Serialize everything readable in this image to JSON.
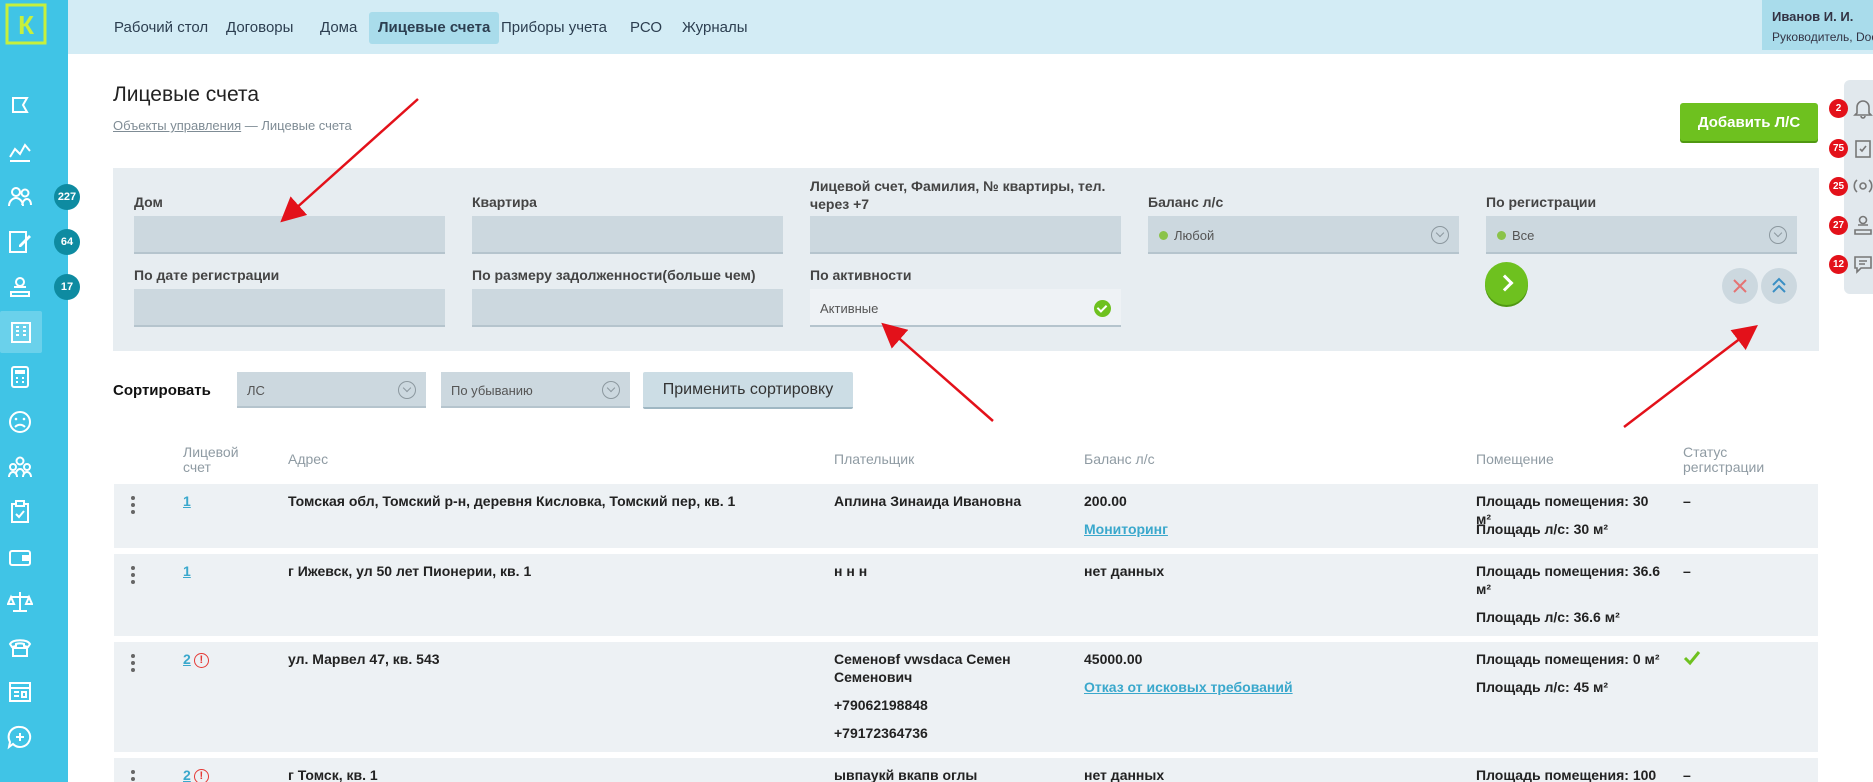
{
  "logo": {
    "letter": "К"
  },
  "nav": {
    "items": [
      "Рабочий стол",
      "Договоры",
      "Дома",
      "Лицевые счета",
      "Приборы учета",
      "РСО",
      "Журналы"
    ],
    "active_index": 3
  },
  "user": {
    "name": "Иванов И. И.",
    "role": "Руководитель, Doctor"
  },
  "sidebar": {
    "icons": [
      "flag-icon",
      "chart-icon",
      "people-icon",
      "edit-document-icon",
      "worker-icon",
      "building-icon",
      "calculator-icon",
      "sad-face-icon",
      "group-icon",
      "clipboard-check-icon",
      "wallet-icon",
      "scales-icon",
      "phone-icon",
      "dashboard-icon",
      "chat-plus-icon"
    ],
    "badges": {
      "people": "227",
      "edit": "64",
      "worker": "17"
    }
  },
  "page": {
    "title": "Лицевые счета",
    "breadcrumb_link": "Объекты управления",
    "breadcrumb_sep": "—",
    "breadcrumb_current": "Лицевые счета",
    "add_button": "Добавить Л/С"
  },
  "filters": {
    "house_label": "Дом",
    "flat_label": "Квартира",
    "search_label": "Лицевой счет, Фамилия, № квартиры, тел. через +7",
    "balance_label": "Баланс л/с",
    "balance_value": "Любой",
    "registration_label": "По регистрации",
    "registration_value": "Все",
    "reg_date_label": "По дате регистрации",
    "debt_label": "По размеру задолженности(больше чем)",
    "activity_label": "По активности",
    "activity_value": "Активные"
  },
  "sorting": {
    "label": "Сортировать",
    "field": "ЛС",
    "order": "По убыванию",
    "apply": "Применить сортировку"
  },
  "table": {
    "headers": {
      "account": "Лицевой счет",
      "address": "Адрес",
      "payer": "Плательщик",
      "balance": "Баланс л/с",
      "premises": "Помещение",
      "reg_status": "Статус регистрации"
    },
    "rows": [
      {
        "account": "1",
        "warning": false,
        "address": "Томская обл, Томский р-н, деревня Кисловка, Томский пер, кв. 1",
        "payer": "Аплина Зинаида Ивановна",
        "phones": [],
        "balance": "200.00",
        "balance_link": "Мониторинг",
        "area": "Площадь помещения: 30 м²",
        "area_ls": "Площадь л/с: 30 м²",
        "status": "–"
      },
      {
        "account": "1",
        "warning": false,
        "address": "г Ижевск, ул 50 лет Пионерии, кв. 1",
        "payer": "н н н",
        "phones": [],
        "balance": "нет данных",
        "balance_link": "",
        "area": "Площадь помещения: 36.6 м²",
        "area_ls": "Площадь л/с: 36.6 м²",
        "status": "–"
      },
      {
        "account": "2",
        "warning": true,
        "address": "ул. Марвел 47, кв. 543",
        "payer": "Семеновf vwsdaca Семен Семенович",
        "phones": [
          "+79062198848",
          "+79172364736"
        ],
        "balance": "45000.00",
        "balance_link": "Отказ от исковых требований",
        "area": "Площадь помещения: 0 м²",
        "area_ls": "Площадь л/с: 45 м²",
        "status": "check"
      },
      {
        "account": "2",
        "warning": true,
        "address": "г Томск, кв. 1",
        "payer": "ывпаукй вкапв оглы",
        "phones": [],
        "balance": "нет данных",
        "balance_link": "",
        "area": "Площадь помещения: 100",
        "area_ls": "",
        "status": "–"
      }
    ]
  },
  "notifications": [
    {
      "icon": "bell-icon",
      "count": "2"
    },
    {
      "icon": "clipboard-check-icon",
      "count": "75"
    },
    {
      "icon": "broadcast-icon",
      "count": "25"
    },
    {
      "icon": "worker-icon",
      "count": "27"
    },
    {
      "icon": "chat-icon",
      "count": "12"
    }
  ],
  "colors": {
    "sidebar": "#40c4e6",
    "topbar": "#d3ecf5",
    "accent_green": "#6ec11f",
    "link": "#3aa8cc",
    "badge_red": "#e3111a",
    "badge_teal": "#0e8ba1",
    "annotation_arrow": "#e3111a"
  }
}
